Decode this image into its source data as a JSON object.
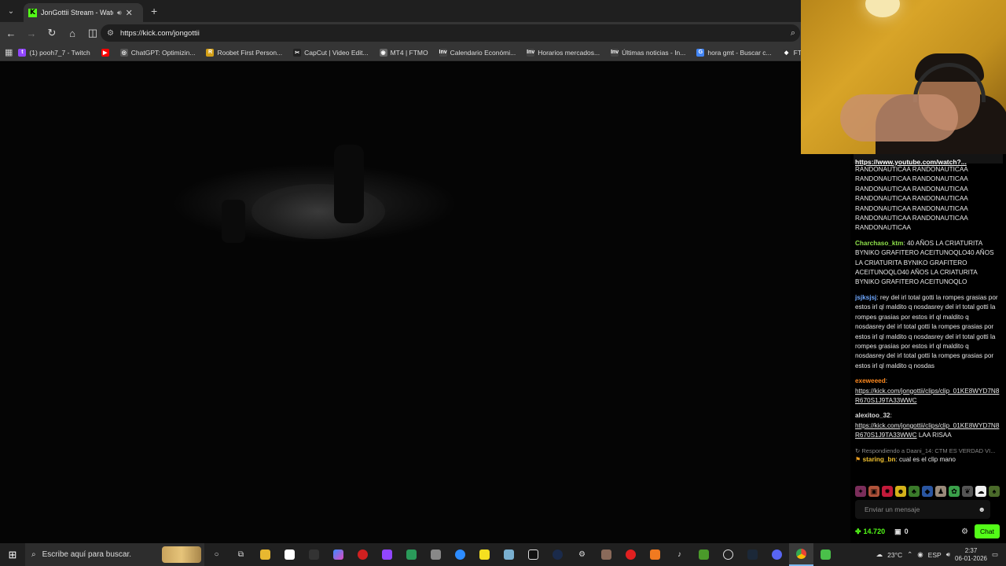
{
  "browser": {
    "tab": {
      "title": "JonGottii Stream - Watch Live",
      "favicon": "K"
    },
    "url": "https://kick.com/jongottii",
    "bookmarks": [
      {
        "label": "(1) pooh7_7 - Twitch",
        "icon": "twitch-icon",
        "color": "#9146ff",
        "glyph": "t"
      },
      {
        "label": "",
        "icon": "youtube-icon",
        "color": "#ff0000",
        "glyph": "▶"
      },
      {
        "label": "ChatGPT: Optimizin...",
        "icon": "chatgpt-icon",
        "color": "#555555",
        "glyph": "◎"
      },
      {
        "label": "Roobet First Person...",
        "icon": "roobet-icon",
        "color": "#d4a017",
        "glyph": "R"
      },
      {
        "label": "CapCut | Video Edit...",
        "icon": "capcut-icon",
        "color": "#222222",
        "glyph": "✂"
      },
      {
        "label": "MT4 | FTMO",
        "icon": "globe-icon",
        "color": "#666666",
        "glyph": "◉"
      },
      {
        "label": "Calendario Económi...",
        "icon": "investing-icon",
        "color": "#444444",
        "glyph": "Inv"
      },
      {
        "label": "Horarios mercados...",
        "icon": "investing-icon",
        "color": "#444444",
        "glyph": "Inv"
      },
      {
        "label": "Últimas noticias - In...",
        "icon": "investing-icon",
        "color": "#444444",
        "glyph": "Inv"
      },
      {
        "label": "hora gmt - Buscar c...",
        "icon": "google-icon",
        "color": "#4285f4",
        "glyph": "G"
      },
      {
        "label": "FTMO - For Serio",
        "icon": "ftmo-icon",
        "color": "#333333",
        "glyph": "◆"
      }
    ]
  },
  "chat": {
    "pinned_link": "https://www.youtube.com/watch?...",
    "messages": [
      {
        "user": "",
        "user_color": "#ffffff",
        "text": "RANDONAUTICAA RANDONAUTICAA RANDONAUTICAA RANDONAUTICAA RANDONAUTICAA RANDONAUTICAA RANDONAUTICAA RANDONAUTICAA RANDONAUTICAA RANDONAUTICAA RANDONAUTICAA RANDONAUTICAA RANDONAUTICAA",
        "is_link": false
      },
      {
        "user": "Charchaso_ktm",
        "user_color": "#8ee04a",
        "text": "40 AÑOS LA CRIATURITA BYNIKO GRAFITERO ACEITUNOQLO40 AÑOS LA CRIATURITA BYNIKO GRAFITERO ACEITUNOQLO40 AÑOS LA CRIATURITA BYNIKO GRAFITERO ACEITUNOQLO",
        "is_link": false
      },
      {
        "user": "jsjksjsj",
        "user_color": "#6fa8ff",
        "text": "rey del irl total gotti la rompes grasias por estos irl ql maldito q nosdasrey del irl total gotti la rompes grasias por estos irl ql maldito q nosdasrey del irl total gotti la rompes grasias por estos irl ql maldito q nosdasrey del irl total gotti la rompes grasias por estos irl ql maldito q nosdasrey del irl total gotti la rompes grasias por estos irl ql maldito q nosdas",
        "is_link": false
      },
      {
        "user": "exeweeed",
        "user_color": "#ff8a1f",
        "text": "https://kick.com/jongottii/clips/clip_01KE8WYD7N8R670S1J9TA33WWC",
        "is_link": true,
        "suffix": ""
      },
      {
        "user": "alexitoo_32",
        "user_color": "#dddddd",
        "text": "https://kick.com/jongottii/clips/clip_01KE8WYD7N8R670S1J9TA33WWC",
        "is_link": true,
        "suffix": " LAA RISAA"
      }
    ],
    "reply_hint": "Respondiendo a Daani_14: CTM ES VERDAD VI...",
    "last_message": {
      "user": "staring_bn",
      "user_color": "#f2c230",
      "text": "cual es el clip mano"
    },
    "input_placeholder": "Enviar un mensaje",
    "points": "14.720",
    "count": "0",
    "send_label": "Chat"
  },
  "taskbar": {
    "search_placeholder": "Escribe aquí para buscar.",
    "weather": "23°C",
    "language": "ESP",
    "time": "2:37",
    "date": "06-01-2026"
  }
}
